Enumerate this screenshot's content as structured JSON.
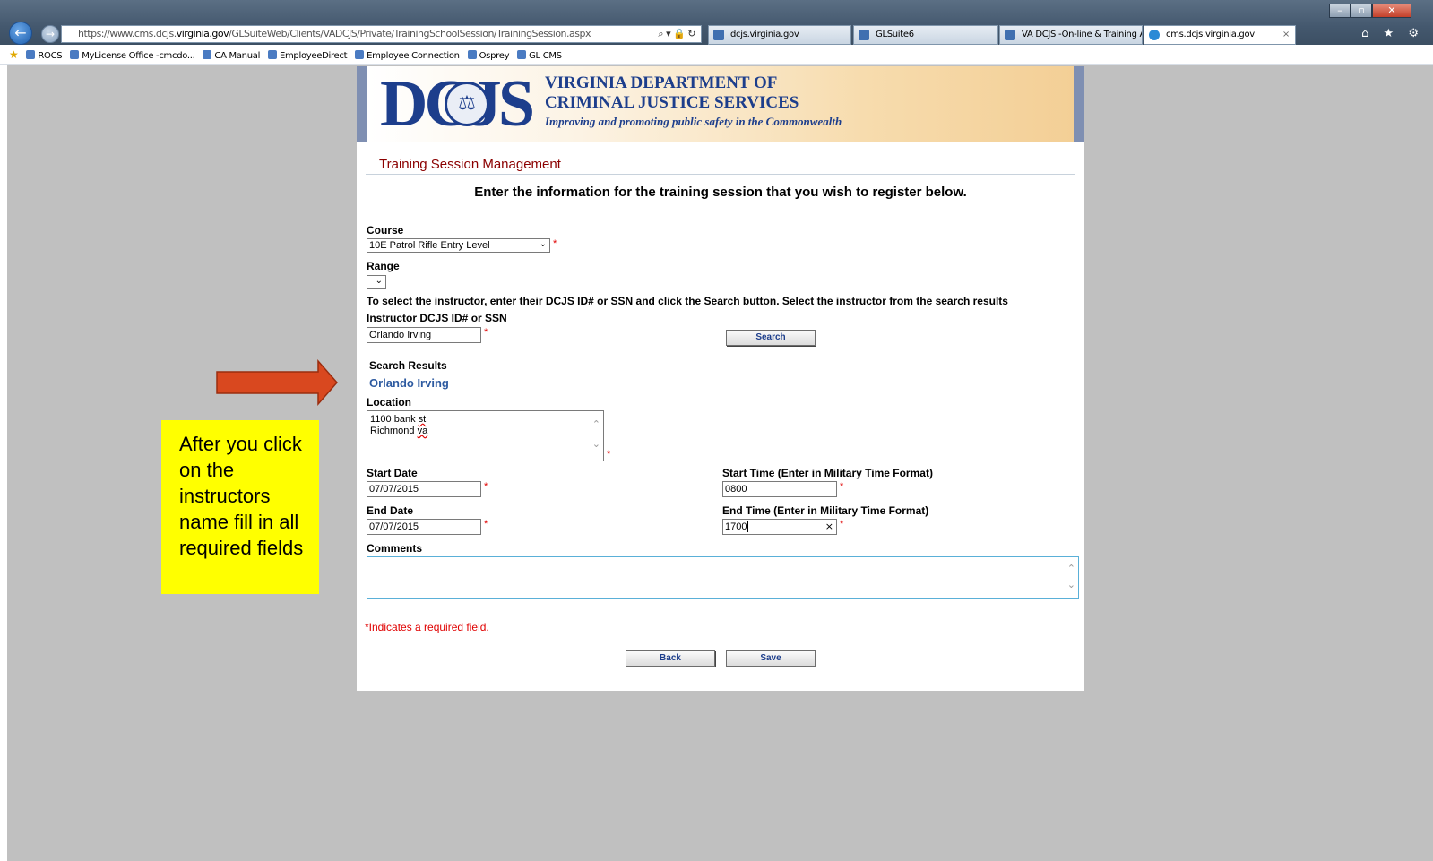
{
  "browser": {
    "url_prefix": "https://www.cms.dcjs.",
    "url_host": "virginia.gov",
    "url_path": "/GLSuiteWeb/Clients/VADCJS/Private/TrainingSchoolSession/TrainingSession.aspx",
    "address_icons": "⌕ ▾ 🔒 ↻",
    "tabs": [
      {
        "label": "dcjs.virginia.gov"
      },
      {
        "label": "GLSuite6"
      },
      {
        "label": "VA DCJS -On-line & Training A..."
      },
      {
        "label": "cms.dcjs.virginia.gov"
      }
    ],
    "window_controls": {
      "minimize": "–",
      "maximize": "▫",
      "close": "✕"
    },
    "tool_icons": "⌂ ★ ⚙",
    "favorites": [
      "ROCS",
      "MyLicense Office -cmcdo...",
      "CA Manual",
      "EmployeeDirect",
      "Employee Connection",
      "Osprey",
      "GL CMS"
    ]
  },
  "header": {
    "logo_text": "DCJS",
    "agency_line1": "VIRGINIA DEPARTMENT OF",
    "agency_line2": "CRIMINAL JUSTICE SERVICES",
    "tagline": "Improving and promoting public safety in the Commonwealth"
  },
  "page": {
    "title": "Training Session Management",
    "instruction": "Enter the information for the training session that you wish to register below."
  },
  "form": {
    "course_label": "Course",
    "course_value": "10E Patrol Rifle Entry Level",
    "range_label": "Range",
    "range_value": "",
    "instructor_help": "To select the instructor, enter their DCJS ID# or SSN and click the Search button. Select the instructor from the search results",
    "instructor_label": "Instructor DCJS ID# or SSN",
    "instructor_value": "Orlando Irving",
    "search_button": "Search",
    "search_results_label": "Search Results",
    "search_result_item": "Orlando Irving",
    "location_label": "Location",
    "location_line1_a": "1100 bank ",
    "location_line1_b": "st",
    "location_line2_a": "Richmond ",
    "location_line2_b": "va",
    "start_date_label": "Start Date",
    "start_date_value": "07/07/2015",
    "start_time_label": "Start Time (Enter in Military Time Format)",
    "start_time_value": "0800",
    "end_date_label": "End Date",
    "end_date_value": "07/07/2015",
    "end_time_label": "End Time (Enter in Military Time Format)",
    "end_time_value": "1700",
    "comments_label": "Comments",
    "comments_value": "",
    "required_marker": "*",
    "required_note": "*Indicates a required field.",
    "back_button": "Back",
    "save_button": "Save"
  },
  "annotation": {
    "callout_text": "After you click on the instructors name fill in all required fields",
    "callout_color": "#ffff00",
    "arrow_color": "#d9481f"
  }
}
